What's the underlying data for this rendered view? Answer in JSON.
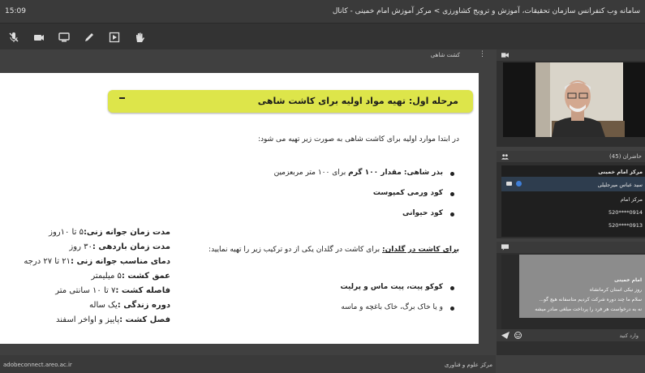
{
  "titlebar": {
    "time": "15:09",
    "title": "سامانه وب کنفرانس سازمان تحقیقات، آموزش و ترویج کشاورزی > مرکز آموزش امام خمینی - کانال"
  },
  "toolbar": {
    "icons": [
      "mic-muted-icon",
      "camera-icon",
      "screen-share-icon",
      "pen-icon",
      "play-icon",
      "raise-hand-icon"
    ]
  },
  "presentation": {
    "header_label": "کشت شاهی",
    "slide_title": "مرحله اول: تهیه مواد اولیه برای کاشت شاهی",
    "intro": "در ابتدا موارد اولیه برای کاشت شاهی به صورت زیر تهیه می شود:",
    "list1": [
      {
        "bold": "بذر شاهی: مقدار ۱۰۰ گرم",
        "rest": " برای ۱۰۰ متر مربعزمین"
      },
      {
        "bold": "کود ورمی کمپوست",
        "rest": ""
      },
      {
        "bold": "کود حیوانی",
        "rest": ""
      }
    ],
    "pot_label": "برای کاشت در گلدان:",
    "pot_text": " برای کاشت در گلدان یکی از دو ترکیب زیر را تهیه نمایید:",
    "list2": [
      {
        "bold": "کوکو پیت، پیت ماس و پرلیت",
        "rest": ""
      },
      {
        "bold": "",
        "rest": "و یا خاک برگ، خاک باغچه و ماسه"
      }
    ],
    "specs": [
      {
        "label": "مدت زمان جوانه زنی:",
        "value": "۵ تا ۱۰روز"
      },
      {
        "label": "مدت زمان باردهی :",
        "value": "۳۰ روز"
      },
      {
        "label": "دمای مناسب جوانه زنی :",
        "value": "۲۱ تا ۲۷ درجه"
      },
      {
        "label": "عمق کشت :",
        "value": "۵ میلیمتر"
      },
      {
        "label": "فاصله کشت :",
        "value": "۷ تا ۱۰ سانتی متر"
      },
      {
        "label": "دوره زندگی :",
        "value": "یک ساله"
      },
      {
        "label": "فصل کشت :",
        "value": "پاییز و اواخر اسفند"
      }
    ],
    "footer_left": "adobeconnect.areo.ac.ir",
    "footer_right": "مرکز علوم و فناوری"
  },
  "attendees": {
    "header": "حاضران (45)",
    "host_label": "مرکز امام خمینی",
    "selected": "سید عباس میرجلیلی",
    "rows": [
      "مرکز امام",
      "0914****520",
      "0913****520"
    ]
  },
  "chat": {
    "sender": "امام خمینی",
    "lines": [
      "روز نیکی استان کرمانشاه",
      "سلام ما چند دوره شرکت کردیم متاسفانه هیچ گو...",
      "نه به درخواست هر فرد را پرداخت مبلغی صادر میشه"
    ],
    "input_placeholder": "وارد کنید"
  }
}
